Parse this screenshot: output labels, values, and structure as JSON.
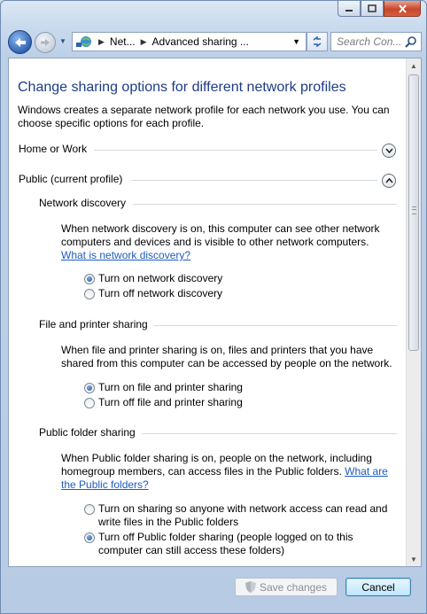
{
  "address": {
    "crumb_1": "Net...",
    "crumb_2": "Advanced sharing ..."
  },
  "search": {
    "placeholder": "Search Con..."
  },
  "page": {
    "title": "Change sharing options for different network profiles",
    "intro_line_1": "Windows creates a separate network profile for each network you use. You can",
    "intro_line_2": "choose specific options for each profile."
  },
  "profiles": {
    "home_or_work": "Home or Work",
    "public": "Public (current profile)"
  },
  "network_discovery": {
    "heading": "Network discovery",
    "desc_line_1": "When network discovery is on, this computer can see other network",
    "desc_line_2": "computers and devices and is visible to other network computers.",
    "link": "What is network discovery?",
    "opt_on": "Turn on network discovery",
    "opt_off": "Turn off network discovery"
  },
  "file_printer": {
    "heading": "File and printer sharing",
    "desc_line_1": "When file and printer sharing is on, files and printers that you have",
    "desc_line_2": "shared from this computer can be accessed by people on the network.",
    "opt_on": "Turn on file and printer sharing",
    "opt_off": "Turn off file and printer sharing"
  },
  "public_folder": {
    "heading": "Public folder sharing",
    "desc_line_1": "When Public folder sharing is on, people on the network, including",
    "desc_line_2_text": "homegroup members, can access files in the Public folders.",
    "desc_line_2_link": "What are",
    "desc_line_3_link": "the Public folders?",
    "opt_on_line_1": "Turn on sharing so anyone with network access can read and",
    "opt_on_line_2": "write files in the Public folders",
    "opt_off_line_1": "Turn off Public folder sharing (people logged on to this",
    "opt_off_line_2": "computer can still access these folders)"
  },
  "footer": {
    "save": "Save changes",
    "cancel": "Cancel"
  },
  "icons": {
    "back": "back-arrow-icon",
    "forward": "forward-arrow-icon",
    "network": "network-icon",
    "refresh": "refresh-icon",
    "search": "search-icon",
    "shield": "uac-shield-icon"
  }
}
